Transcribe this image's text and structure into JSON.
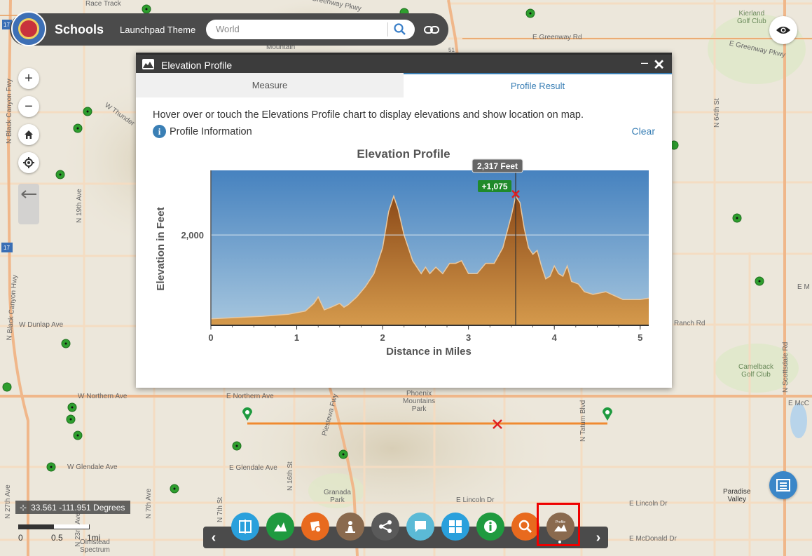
{
  "header": {
    "title": "Schools",
    "theme_label": "Launchpad Theme",
    "search_placeholder": "World"
  },
  "map": {
    "labels": {
      "race_track": "Race Track",
      "greenway_pkwy": "Greenway Pkwy",
      "e_greenway_rd": "E Greenway Rd",
      "e_greenway_pkwy": "E Greenway Pkwy",
      "kierland": "Kierland\nGolf Club",
      "mountain": "Mountain",
      "w_thunder": "W Thunder",
      "n_19th_ave": "N 19th Ave",
      "n_black_canyon_fwy": "N Black Canyon Fwy",
      "n_black_canyon_hwy": "N Black Canyon Hwy",
      "w_dunlap": "W Dunlap Ave",
      "w_northern": "W Northern Ave",
      "e_northern": "E Northern Ave",
      "w_glendale": "W Glendale Ave",
      "e_glendale": "E Glendale Ave",
      "phoenix_mountains_park": "Phoenix\nMountains\nPark",
      "granada_park": "Granada\nPark",
      "e_lincoln_dr": "E Lincoln Dr",
      "e_lincoln_dr_2": "E Lincoln Dr",
      "paradise_valley": "Paradise\nValley",
      "e_mcdonald": "E McDonald Dr",
      "camelback_golf": "Camelback\nGolf Club",
      "n_scottsdale": "N Scottsdale Rd",
      "ranch_rd": "Ranch Rd",
      "n_64th": "N 64th St",
      "n_tatum": "N Tatum Blvd",
      "n_16th": "N 16th St",
      "n_7th_st": "N 7th St",
      "n_7th_ave": "N 7th Ave",
      "n_27th": "N 27th Ave",
      "n_23rd": "N 23rd Ave",
      "piestewa": "Piestewa Fwy",
      "olmstead": "Olmstead\nSpectrum",
      "e_mcc": "E McC",
      "e_m": "E M",
      "hwy17": "17",
      "hwy51": "51"
    }
  },
  "panel": {
    "title": "Elevation Profile",
    "tabs": [
      "Measure",
      "Profile Result"
    ],
    "instructions": "Hover over or touch the Elevations Profile chart to display elevations and show location on map.",
    "info_label": "Profile Information",
    "clear_label": "Clear",
    "tooltip_value": "2,317 Feet",
    "gain_badge": "+1,075"
  },
  "chart_data": {
    "type": "area",
    "title": "Elevation Profile",
    "xlabel": "Distance in Miles",
    "ylabel": "Elevation in Feet",
    "xlim": [
      0,
      5.1
    ],
    "ylim": [
      1300,
      2500
    ],
    "xticks": [
      0,
      1,
      2,
      3,
      4,
      5
    ],
    "ytick_labels": [
      {
        "value": 2000,
        "label": "2,000"
      }
    ],
    "grid": false,
    "series": [
      {
        "x": [
          0,
          0.3,
          0.6,
          0.9,
          1.1,
          1.2,
          1.25,
          1.32,
          1.4,
          1.5,
          1.55,
          1.6,
          1.7,
          1.8,
          1.9,
          2.0,
          2.07,
          2.13,
          2.18,
          2.25,
          2.35,
          2.45,
          2.5,
          2.55,
          2.62,
          2.7,
          2.78,
          2.85,
          2.92,
          3.0,
          3.1,
          3.2,
          3.3,
          3.4,
          3.5,
          3.55,
          3.6,
          3.65,
          3.7,
          3.75,
          3.8,
          3.85,
          3.9,
          3.95,
          4.0,
          4.05,
          4.1,
          4.15,
          4.2,
          4.28,
          4.35,
          4.45,
          4.6,
          4.8,
          5.0,
          5.1
        ],
        "y": [
          1350,
          1360,
          1370,
          1385,
          1410,
          1470,
          1520,
          1420,
          1440,
          1470,
          1440,
          1460,
          1520,
          1600,
          1700,
          1900,
          2180,
          2300,
          2200,
          2000,
          1800,
          1700,
          1750,
          1700,
          1750,
          1700,
          1780,
          1780,
          1800,
          1700,
          1700,
          1780,
          1780,
          1900,
          2150,
          2300,
          2250,
          2050,
          1900,
          1850,
          1880,
          1760,
          1660,
          1680,
          1760,
          1700,
          1680,
          1760,
          1640,
          1620,
          1560,
          1540,
          1560,
          1500,
          1500,
          1510
        ]
      }
    ],
    "cursor": {
      "x": 3.55,
      "y": 2317,
      "label": "2,317 Feet"
    },
    "colors": {
      "sky_top": "#4682bf",
      "sky_bottom": "#a6c6de",
      "terrain_top": "#8c4a18",
      "terrain_bottom": "#d59a4c"
    }
  },
  "toolbar": {
    "tools": [
      {
        "name": "swipe-icon",
        "color": "#2aa0dc"
      },
      {
        "name": "elevation-icon",
        "color": "#1f9a3f"
      },
      {
        "name": "layers-icon",
        "color": "#e86a1e"
      },
      {
        "name": "directions-icon",
        "color": "#8a6a4e"
      },
      {
        "name": "share-icon",
        "color": "#5a5a5a"
      },
      {
        "name": "chat-icon",
        "color": "#5bbad6"
      },
      {
        "name": "basemap-gallery-icon",
        "color": "#2aa0dc"
      },
      {
        "name": "about-icon",
        "color": "#1f9a3f"
      },
      {
        "name": "query-icon",
        "color": "#e86a1e"
      },
      {
        "name": "profile-icon",
        "color": "#8a6a4e"
      }
    ],
    "profile_label": "Profile"
  },
  "coordinates": "33.561 -111.951 Degrees",
  "scale": {
    "labels": [
      "0",
      "0.5",
      "1mi"
    ]
  }
}
